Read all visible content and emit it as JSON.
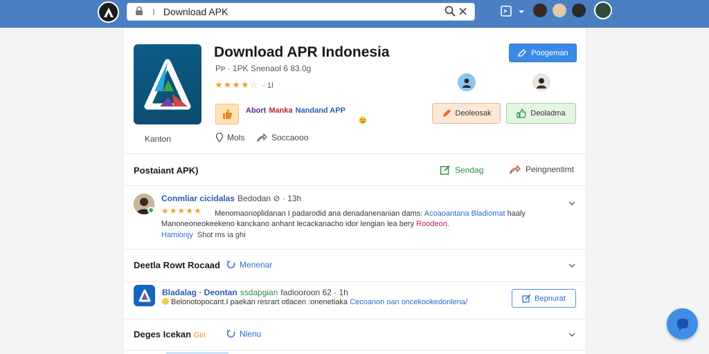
{
  "topbar": {
    "search_prefix": "I",
    "search_query": "Download APK"
  },
  "app": {
    "title": "Download APR Indonesia",
    "meta": "Pᴘ · 1PK  Snenaol 6  83.0g",
    "rating_stars": "★★★★",
    "rating_empty": "☆",
    "rating_count": "· 1l",
    "promo_a": "Abort",
    "promo_b": "Manka",
    "promo_c": "Nandand APP",
    "primary_button": "Poogeman",
    "orange_button": "Deoleosak",
    "green_button": "Deoladma",
    "category": "Kanton",
    "location": "Mols",
    "share": "Soccaooo"
  },
  "colors": {
    "accent": "#3a8ae6",
    "topbar": "#4a7fc4",
    "star": "#f0a22d",
    "green": "#2f8b3a"
  },
  "section1": {
    "title": "Postaiant APK)",
    "action_green": "Sendag",
    "action_share": "Peingnentimt"
  },
  "review": {
    "name": "Conmliar cicidalas",
    "sub": "Bedodan  ⊘ · 13h",
    "stars": "★★★★★",
    "line1_text": "Menomaonoplidanan  I  padarodid ana denadanenanian dams:",
    "line1_hl": "Acoaoantana Bladiomat",
    "line1_end": "haaly",
    "line2_text": "Manoneoneokeekeno kanckano anhant lecackanacho idor lengian lea bery",
    "line2_hl": "Roodeon.",
    "foot_link": "Hamionjy",
    "foot_text": "Shot ms ia ghi"
  },
  "section2": {
    "title": "Deetla Rowt Rocaad",
    "link": "Menenar"
  },
  "item": {
    "name": "Bladalag · Deontan",
    "green": "ssdapgian",
    "meta": "fadiooroon  62 · 1h",
    "line_text": "Belonotopocant.I  paekan  resrart otlacen  :onenetiaka",
    "line_hl": "Cecoanon oan oncekookedonlena/",
    "button": "Bepnurat"
  },
  "section3": {
    "title": "Deges Icekan",
    "tag": "Giri",
    "link": "Nlenu"
  }
}
